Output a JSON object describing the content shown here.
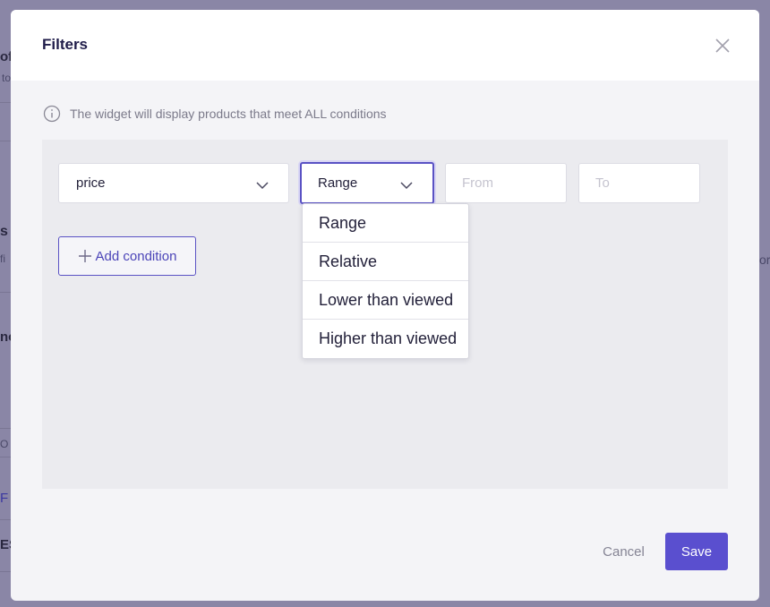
{
  "background": {
    "fragments": [
      "of",
      "to",
      "s",
      "fi",
      "no",
      "O",
      "F",
      "ES",
      "or"
    ]
  },
  "modal": {
    "title": "Filters",
    "info_text": "The widget will display products that meet ALL conditions",
    "condition": {
      "field_value": "price",
      "operator_value": "Range",
      "from_placeholder": "From",
      "to_placeholder": "To"
    },
    "operator_options": [
      "Range",
      "Relative",
      "Lower than viewed",
      "Higher than viewed"
    ],
    "add_condition_label": "Add condition",
    "cancel_label": "Cancel",
    "save_label": "Save"
  },
  "colors": {
    "accent": "#5a4fcf",
    "title": "#201d4a",
    "overlay": "#8a86a6"
  },
  "icons": {
    "close": "close-icon",
    "info": "info-icon",
    "chevron": "chevron-down-icon",
    "plus": "plus-icon"
  }
}
